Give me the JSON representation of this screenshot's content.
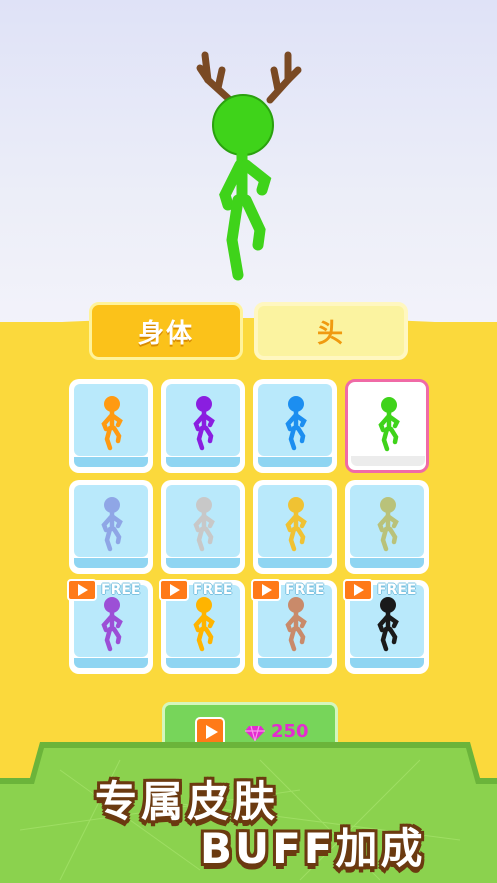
{
  "tabs": [
    {
      "label": "身体",
      "active": true
    },
    {
      "label": "头",
      "active": false
    }
  ],
  "skins": [
    {
      "icon": "stickman-icon",
      "color": "#ff9a12",
      "selected": false,
      "free": false
    },
    {
      "icon": "stickman-icon",
      "color": "#8a1ee0",
      "selected": false,
      "free": false
    },
    {
      "icon": "stickman-icon",
      "color": "#1c8ef0",
      "selected": false,
      "free": false
    },
    {
      "icon": "stickman-icon",
      "color": "#3fd31a",
      "selected": true,
      "free": false
    },
    {
      "icon": "stickman-icon",
      "color": "#8fa6e6",
      "selected": false,
      "free": false
    },
    {
      "icon": "stickman-icon",
      "color": "#c8c8c8",
      "selected": false,
      "free": false
    },
    {
      "icon": "stickman-icon",
      "color": "#f0c233",
      "selected": false,
      "free": false
    },
    {
      "icon": "stickman-icon",
      "color": "#b9c27a",
      "selected": false,
      "free": false
    },
    {
      "icon": "stickman-icon",
      "color": "#9c4fd6",
      "selected": false,
      "free": true
    },
    {
      "icon": "stickman-icon",
      "color": "#ffb400",
      "selected": false,
      "free": true
    },
    {
      "icon": "stickman-icon",
      "color": "#c98a6a",
      "selected": false,
      "free": true
    },
    {
      "icon": "stickman-icon",
      "color": "#1a1a1a",
      "selected": false,
      "free": true
    }
  ],
  "free_label": "FREE",
  "buy": {
    "price": "250",
    "gem_color": "#e42bd0"
  },
  "banner": {
    "line1": "专属皮肤",
    "line2": "BUFF加成"
  },
  "colors": {
    "ground": "#fbd93c",
    "preview_character": "#3fd31a",
    "antler": "#7a4a24"
  }
}
